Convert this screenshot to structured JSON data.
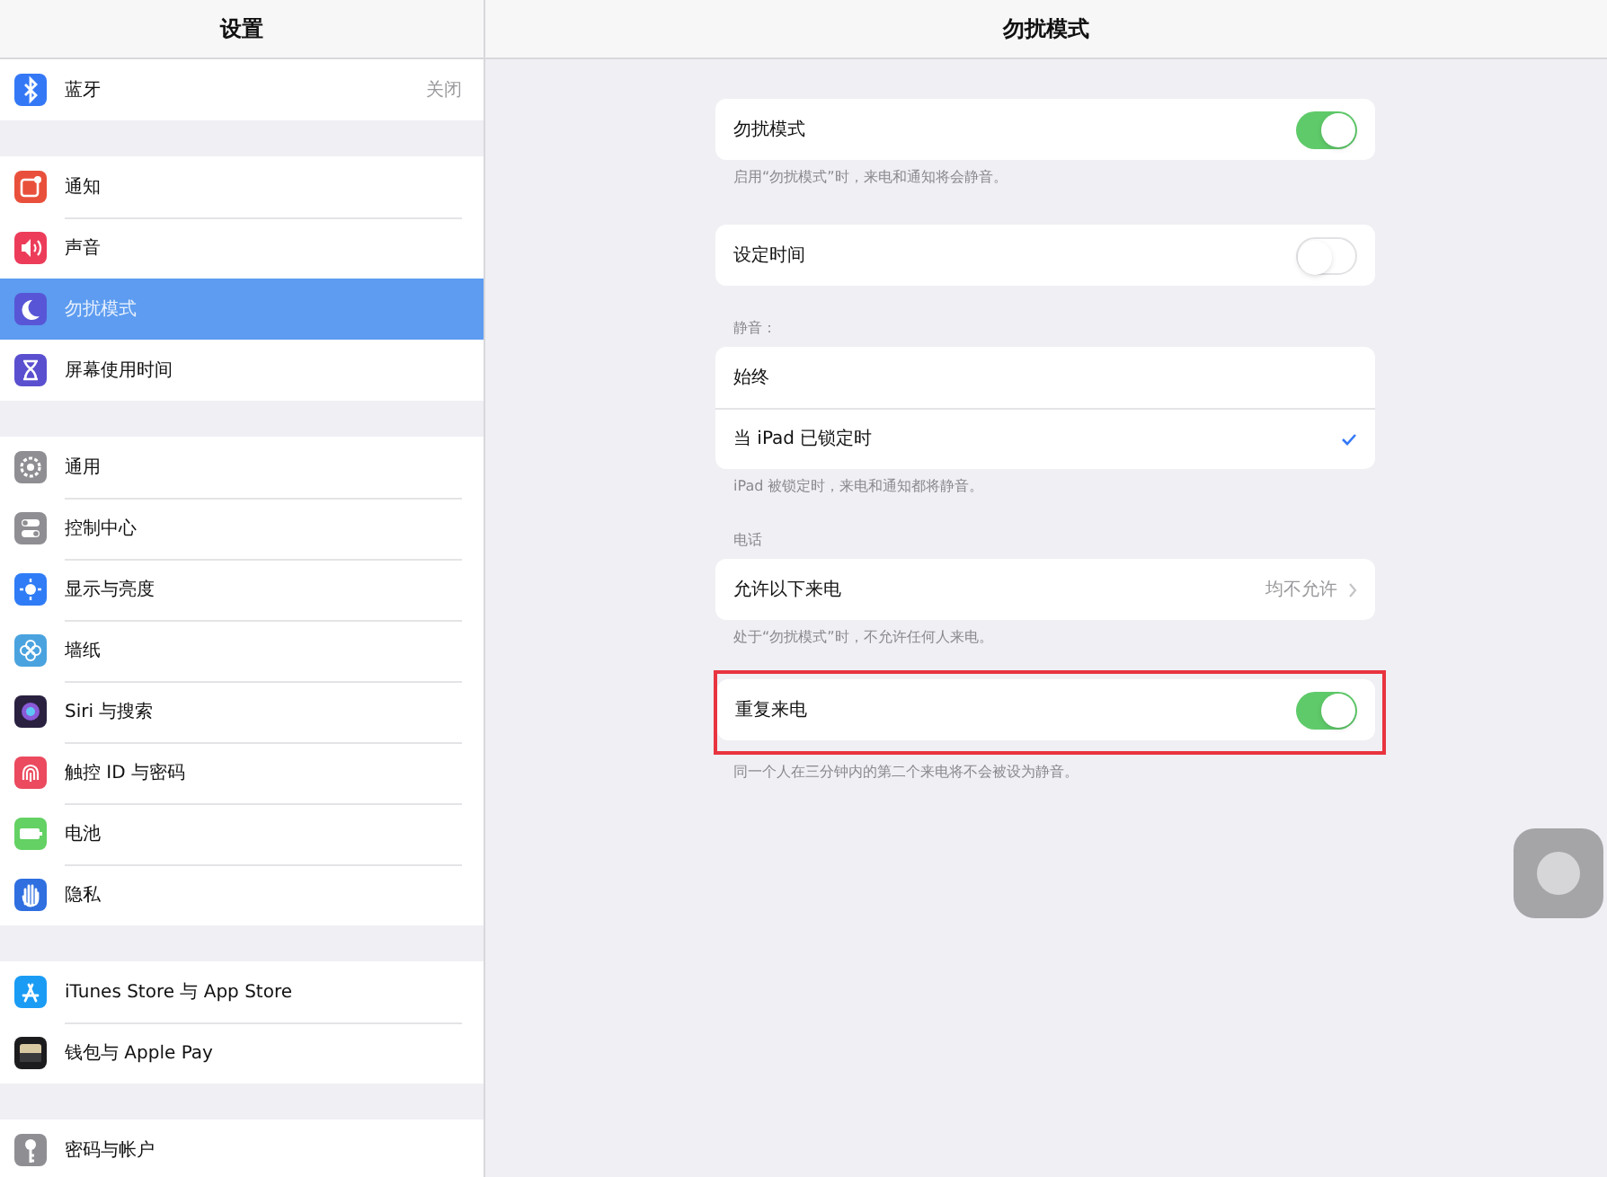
{
  "sidebar": {
    "title": "设置",
    "groups": [
      {
        "items": [
          {
            "label": "蓝牙",
            "value": "关闭",
            "selected": false
          }
        ]
      },
      {
        "items": [
          {
            "label": "通知",
            "selected": false
          },
          {
            "label": "声音",
            "selected": false
          },
          {
            "label": "勿扰模式",
            "selected": true
          },
          {
            "label": "屏幕使用时间",
            "selected": false
          }
        ]
      },
      {
        "items": [
          {
            "label": "通用",
            "selected": false
          },
          {
            "label": "控制中心",
            "selected": false
          },
          {
            "label": "显示与亮度",
            "selected": false
          },
          {
            "label": "墙纸",
            "selected": false
          },
          {
            "label": "Siri 与搜索",
            "selected": false
          },
          {
            "label": "触控 ID 与密码",
            "selected": false
          },
          {
            "label": "电池",
            "selected": false
          },
          {
            "label": "隐私",
            "selected": false
          }
        ]
      },
      {
        "items": [
          {
            "label": "iTunes Store 与 App Store",
            "selected": false
          },
          {
            "label": "钱包与 Apple Pay",
            "selected": false
          }
        ]
      },
      {
        "items": [
          {
            "label": "密码与帐户",
            "selected": false
          }
        ]
      }
    ]
  },
  "detail": {
    "title": "勿扰模式",
    "sections": [
      {
        "highlighted": false,
        "rows": [
          {
            "kind": "toggle",
            "label": "勿扰模式",
            "on": true
          }
        ],
        "footer": "启用“勿扰模式”时，来电和通知将会静音。"
      },
      {
        "highlighted": false,
        "rows": [
          {
            "kind": "toggle",
            "label": "设定时间",
            "on": false
          }
        ]
      },
      {
        "highlighted": false,
        "header": "静音：",
        "rows": [
          {
            "kind": "option",
            "label": "始终",
            "checked": false
          },
          {
            "kind": "option",
            "label": "当 iPad 已锁定时",
            "checked": true
          }
        ],
        "footer": "iPad 被锁定时，来电和通知都将静音。"
      },
      {
        "highlighted": false,
        "header": "电话",
        "rows": [
          {
            "kind": "link",
            "label": "允许以下来电",
            "value": "均不允许"
          }
        ],
        "footer": "处于“勿扰模式”时，不允许任何人来电。"
      },
      {
        "highlighted": true,
        "rows": [
          {
            "kind": "toggle",
            "label": "重复来电",
            "on": true
          }
        ],
        "footer": "同一个人在三分钟内的第二个来电将不会被设为静音。"
      }
    ]
  }
}
